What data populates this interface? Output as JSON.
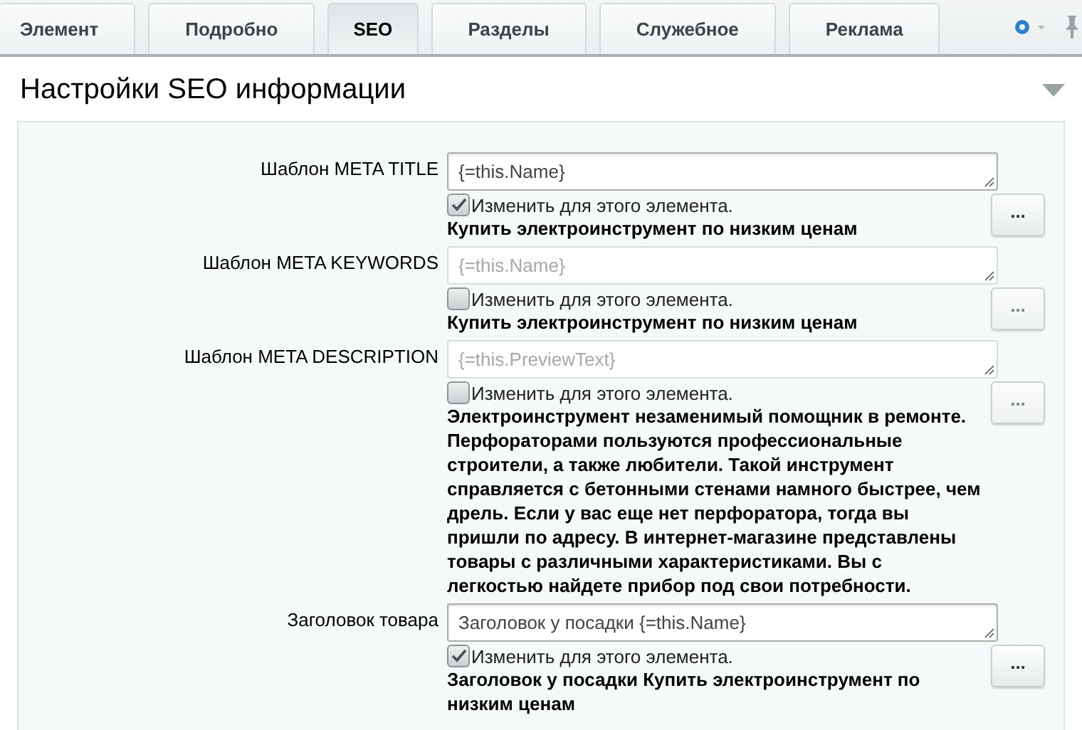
{
  "tabs": [
    {
      "label": "Элемент",
      "selected": false
    },
    {
      "label": "Подробно",
      "selected": false
    },
    {
      "label": "SEO",
      "selected": true
    },
    {
      "label": "Разделы",
      "selected": false
    },
    {
      "label": "Служебное",
      "selected": false
    },
    {
      "label": "Реклама",
      "selected": false
    }
  ],
  "section": {
    "title": "Настройки SEO информации",
    "expanded": true
  },
  "fields": [
    {
      "label": "Шаблон META TITLE",
      "value": "{=this.Name}",
      "checkbox_label": "Изменить для этого элемента.",
      "checked": true,
      "result": "Купить электроинструмент по низким ценам",
      "button": "..."
    },
    {
      "label": "Шаблон META KEYWORDS",
      "value": "{=this.Name}",
      "checkbox_label": "Изменить для этого элемента.",
      "checked": false,
      "result": "Купить электроинструмент по низким ценам",
      "button": "..."
    },
    {
      "label": "Шаблон META DESCRIPTION",
      "value": "{=this.PreviewText}",
      "checkbox_label": "Изменить для этого элемента.",
      "checked": false,
      "result": "Электроинструмент незаменимый помощник в ремонте. Перфораторами пользуются профессиональные строители, а также любители. Такой инструмент справляется с бетонными стенами намного быстрее, чем дрель. Если у вас еще нет перфоратора, тогда вы пришли по адресу. В интернет-магазине представлены товары с различными характеристиками. Вы с легкостью найдете прибор под свои потребности.",
      "button": "..."
    },
    {
      "label": "Заголовок товара",
      "value": "Заголовок у посадки {=this.Name}",
      "checkbox_label": "Изменить для этого элемента.",
      "checked": true,
      "result": "Заголовок у посадки Купить электроинструмент по низким ценам",
      "button": "..."
    }
  ]
}
